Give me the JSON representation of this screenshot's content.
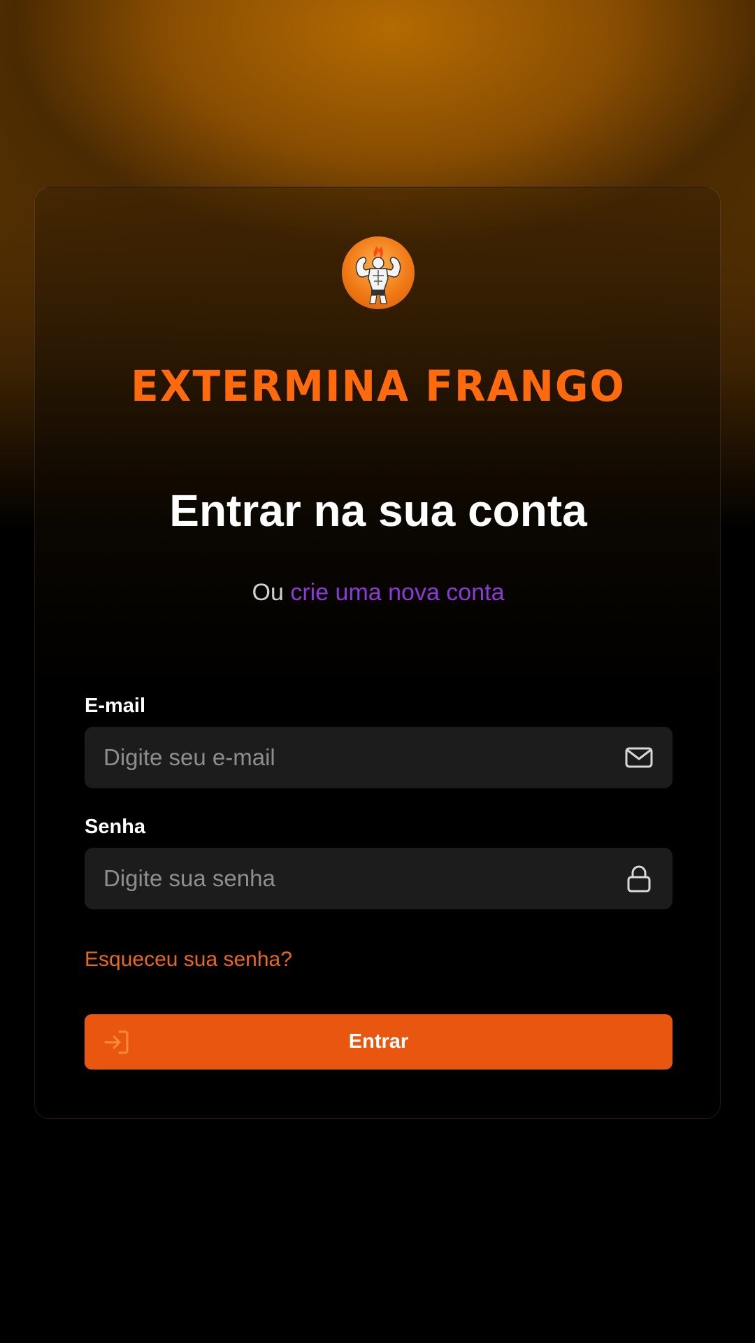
{
  "brand": {
    "name": "EXTERMINA FRANGO"
  },
  "heading": {
    "title": "Entrar na sua conta",
    "subtitle_prefix": "Ou",
    "subtitle_link": "crie uma nova conta"
  },
  "form": {
    "email": {
      "label": "E-mail",
      "placeholder": "Digite seu e-mail",
      "value": ""
    },
    "password": {
      "label": "Senha",
      "placeholder": "Digite sua senha",
      "value": ""
    },
    "forgot_link": "Esqueceu sua senha?",
    "submit_label": "Entrar"
  },
  "icons": {
    "logo": "bodybuilder-logo-icon",
    "email": "mail-icon",
    "password": "lock-icon",
    "submit": "login-icon"
  },
  "colors": {
    "accent_orange": "#e8560f",
    "brand_orange": "#ff6a0c",
    "link_purple": "#8b3ad8",
    "forgot_orange": "#e8691a",
    "field_bg": "#1c1c1c"
  }
}
